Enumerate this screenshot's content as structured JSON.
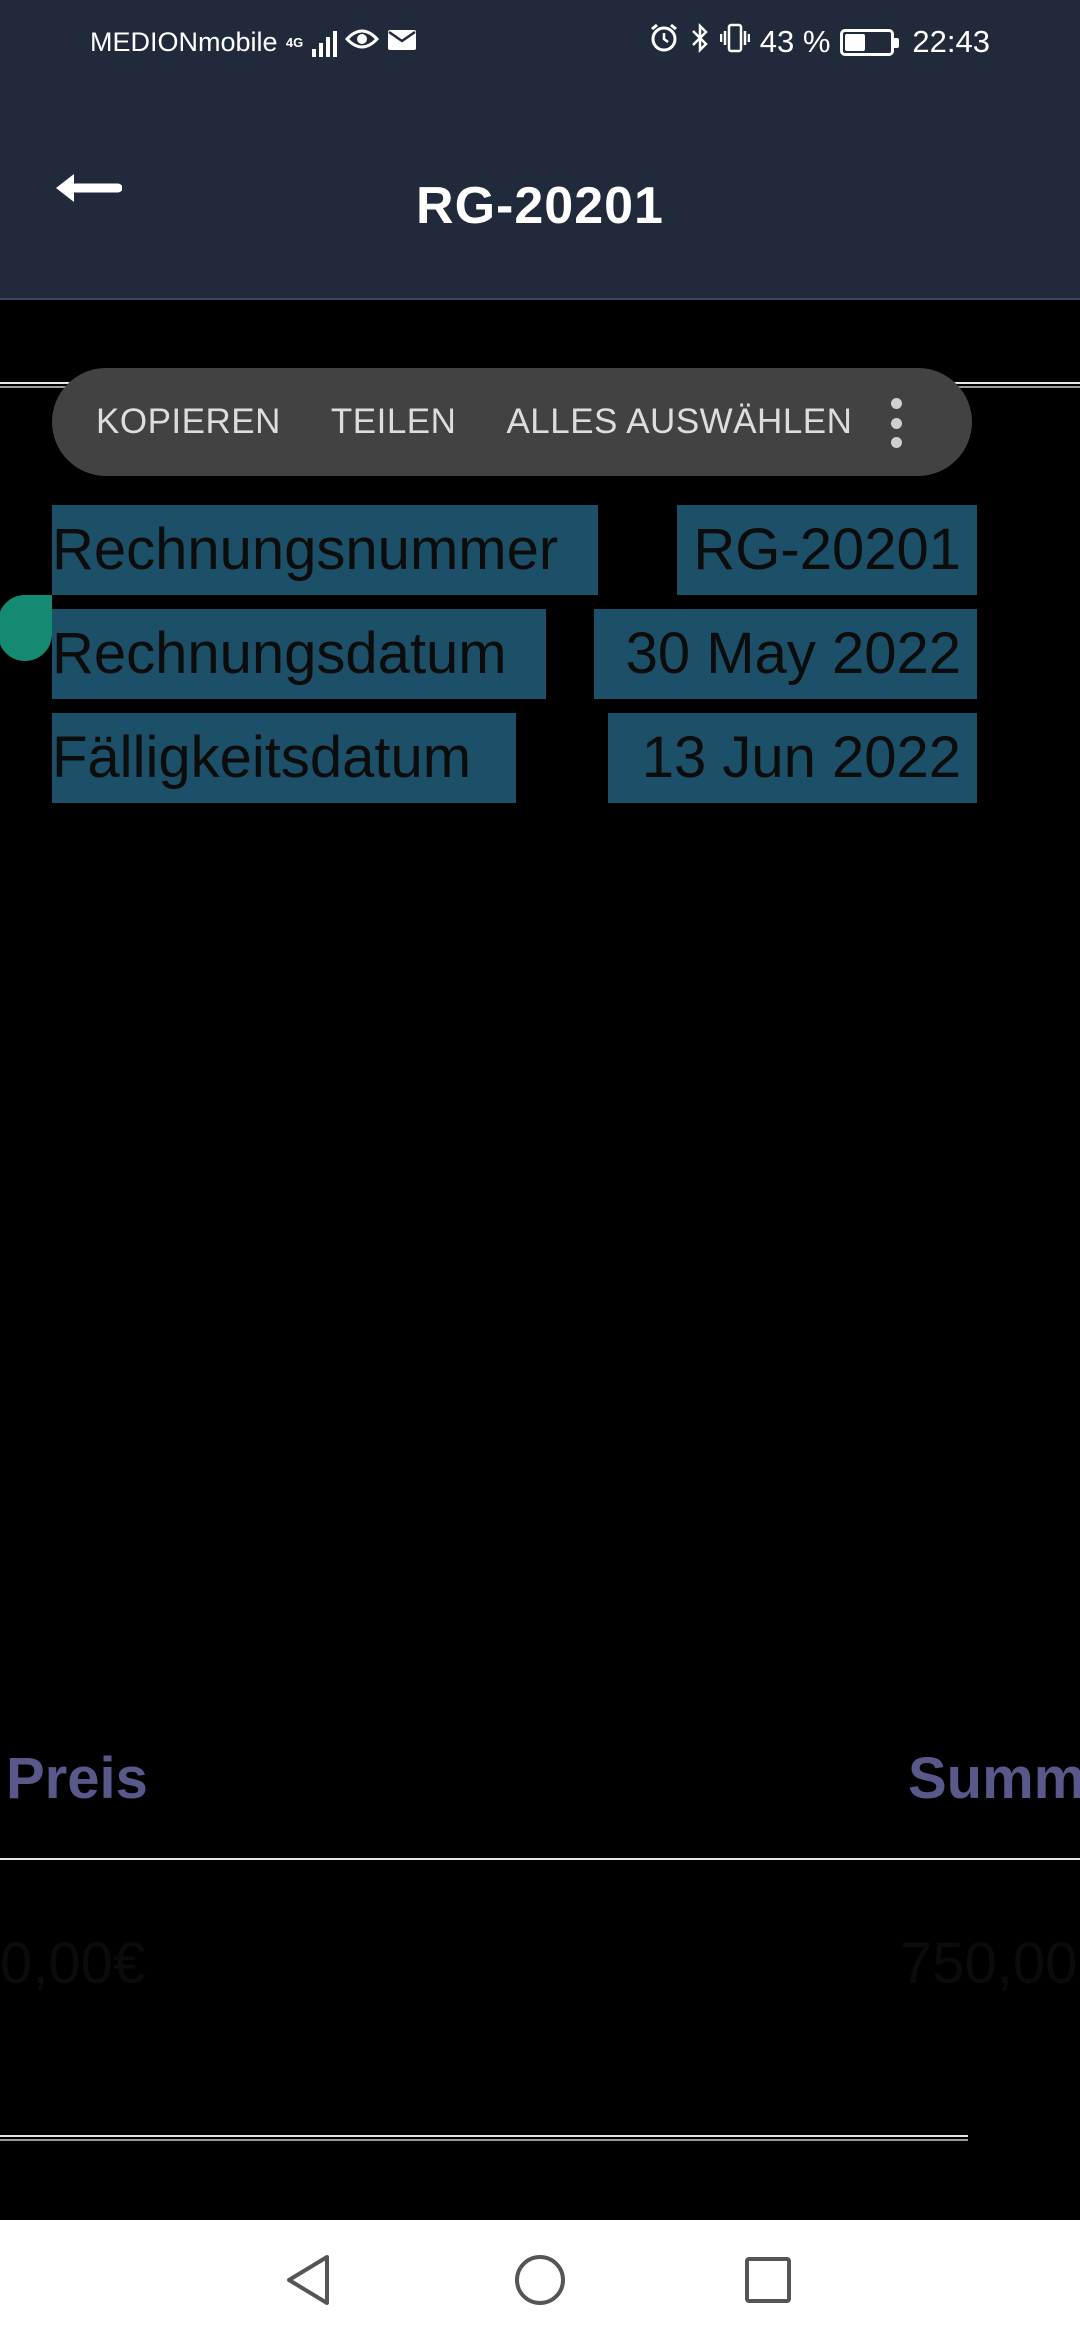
{
  "status_bar": {
    "carrier": "MEDIONmobile",
    "network": "4G",
    "battery": "43 %",
    "battery_level": 0.43,
    "time": "22:43"
  },
  "app_bar": {
    "title": "RG-20201"
  },
  "selection_toolbar": {
    "actions": [
      "KOPIEREN",
      "TEILEN",
      "ALLES AUSWÄHLEN"
    ]
  },
  "invoice_info": [
    {
      "label": "Rechnungsnummer",
      "value": "RG-20201"
    },
    {
      "label": "Rechnungsdatum",
      "value": "30 May 2022"
    },
    {
      "label": "Fälligkeitsdatum",
      "value": "13 Jun 2022"
    }
  ],
  "table": {
    "headers": {
      "price": "Preis",
      "sum": "Summ"
    },
    "row": {
      "price": "0,00€",
      "sum": "750,00"
    }
  },
  "icons": {
    "back": "arrow-left-icon",
    "more": "more-vertical-icon",
    "nav_back": "triangle-back-icon",
    "nav_home": "circle-home-icon",
    "nav_recents": "square-recents-icon"
  }
}
